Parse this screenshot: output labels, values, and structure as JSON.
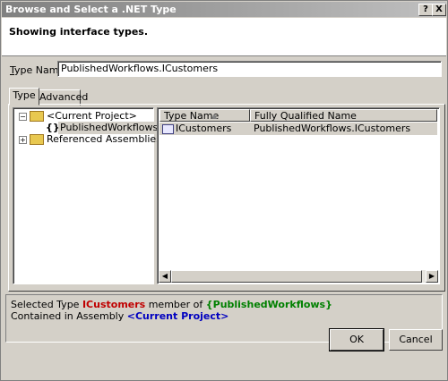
{
  "window": {
    "title": "Browse and Select a .NET Type",
    "help_btn": "?",
    "close_btn": "X"
  },
  "header": {
    "text": "Showing interface types."
  },
  "type_name": {
    "label_prefix": "T",
    "label_rest": "ype Name:",
    "value": "PublishedWorkflows.ICustomers"
  },
  "tabs": [
    {
      "label": "Type"
    },
    {
      "label": "Advanced"
    }
  ],
  "tree": {
    "items": [
      {
        "label": "<Current Project>",
        "expander": "−"
      },
      {
        "label": "PublishedWorkflows",
        "glyph": "{}"
      },
      {
        "label": "Referenced Assemblies",
        "expander": "+"
      }
    ]
  },
  "list": {
    "columns": [
      {
        "label": "Type Name",
        "sort": "▲"
      },
      {
        "label": "Fully Qualified Name"
      }
    ],
    "rows": [
      {
        "type_name": "ICustomers",
        "qualified": "PublishedWorkflows.ICustomers"
      }
    ]
  },
  "description": {
    "line1_prefix": "Selected Type ",
    "line1_type": "ICustomers",
    "line1_mid": " member of ",
    "line1_ns": "{PublishedWorkflows}",
    "line2_prefix": "Contained in Assembly ",
    "line2_asm": "<Current Project>"
  },
  "buttons": {
    "ok": "OK",
    "cancel": "Cancel"
  }
}
